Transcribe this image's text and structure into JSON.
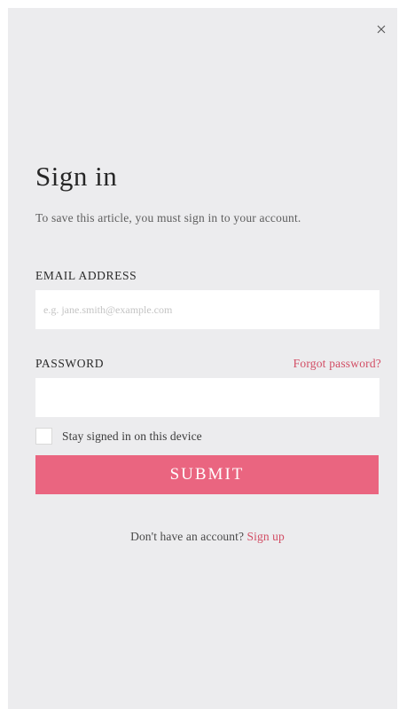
{
  "modal": {
    "close_icon": "close-icon",
    "title": "Sign in",
    "subtitle": "To save this article, you must sign in to your account."
  },
  "form": {
    "email_label": "EMAIL ADDRESS",
    "email_placeholder": "e.g. jane.smith@example.com",
    "email_value": "",
    "password_label": "PASSWORD",
    "password_value": "",
    "forgot_password": "Forgot password?",
    "stay_signed_in": "Stay signed in on this device",
    "stay_signed_in_checked": false,
    "submit_label": "SUBMIT"
  },
  "footer": {
    "prompt": "Don't have an account?",
    "signup_link": "Sign up"
  },
  "colors": {
    "panel_bg": "#ececee",
    "accent": "#ea6580",
    "link": "#d24d64"
  }
}
